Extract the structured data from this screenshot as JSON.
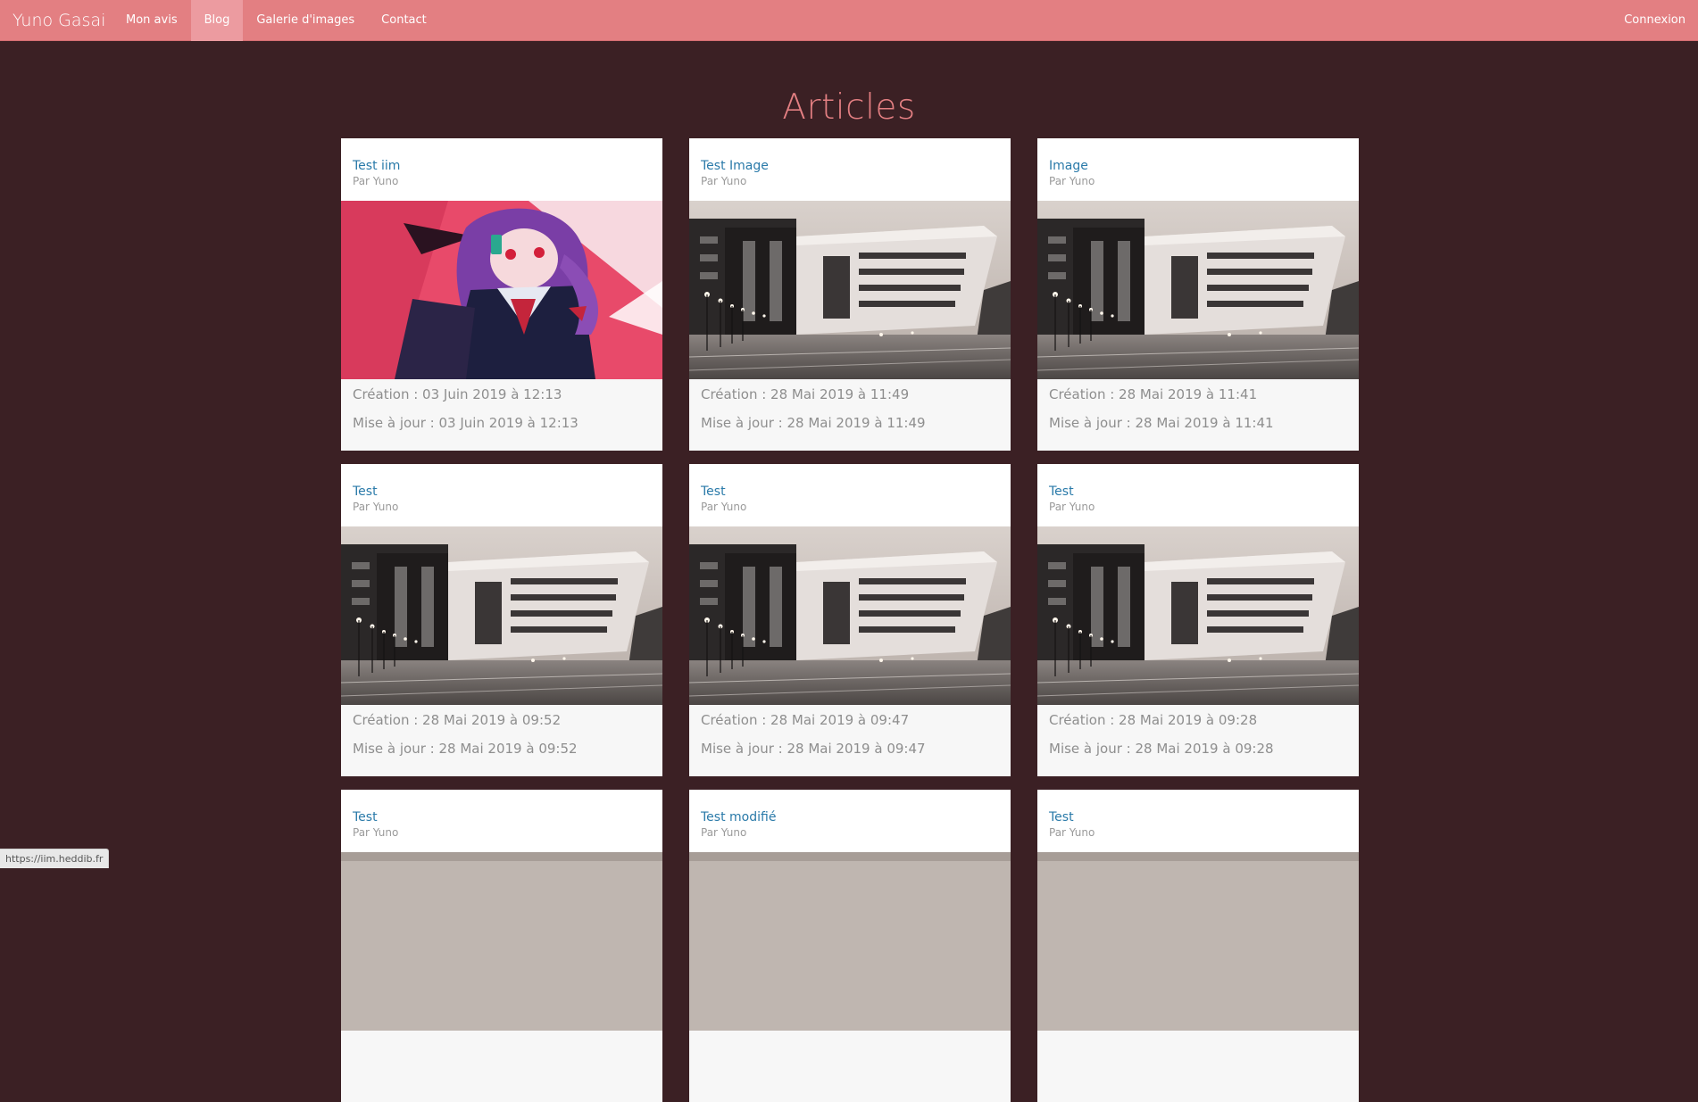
{
  "nav": {
    "brand": "Yuno Gasai",
    "links": [
      "Mon avis",
      "Blog",
      "Galerie d'images",
      "Contact"
    ],
    "active": "Blog",
    "login": "Connexion"
  },
  "page_title": "Articles",
  "articles": [
    {
      "title": "Test iim",
      "author": "Par Yuno",
      "image": "anime-girl",
      "created": "Création : 03 Juin 2019 à 12:13",
      "updated": "Mise à jour : 03 Juin 2019 à 12:13"
    },
    {
      "title": "Test Image",
      "author": "Par Yuno",
      "image": "building",
      "created": "Création : 28 Mai 2019 à 11:49",
      "updated": "Mise à jour : 28 Mai 2019 à 11:49"
    },
    {
      "title": "Image",
      "author": "Par Yuno",
      "image": "building",
      "created": "Création : 28 Mai 2019 à 11:41",
      "updated": "Mise à jour : 28 Mai 2019 à 11:41"
    },
    {
      "title": "Test",
      "author": "Par Yuno",
      "image": "building",
      "created": "Création : 28 Mai 2019 à 09:52",
      "updated": "Mise à jour : 28 Mai 2019 à 09:52"
    },
    {
      "title": "Test",
      "author": "Par Yuno",
      "image": "building",
      "created": "Création : 28 Mai 2019 à 09:47",
      "updated": "Mise à jour : 28 Mai 2019 à 09:47"
    },
    {
      "title": "Test",
      "author": "Par Yuno",
      "image": "building",
      "created": "Création : 28 Mai 2019 à 09:28",
      "updated": "Mise à jour : 28 Mai 2019 à 09:28"
    },
    {
      "title": "Test",
      "author": "Par Yuno",
      "image": "building-partial"
    },
    {
      "title": "Test modifié",
      "author": "Par Yuno",
      "image": "building-partial"
    },
    {
      "title": "Test",
      "author": "Par Yuno",
      "image": "building-partial"
    }
  ],
  "status_bar": {
    "url": "https://iim.heddib.fr"
  },
  "colors": {
    "navbar": "#e37f82",
    "background": "#3b2024",
    "accent": "#e37f82",
    "link": "#2a7aa9"
  }
}
